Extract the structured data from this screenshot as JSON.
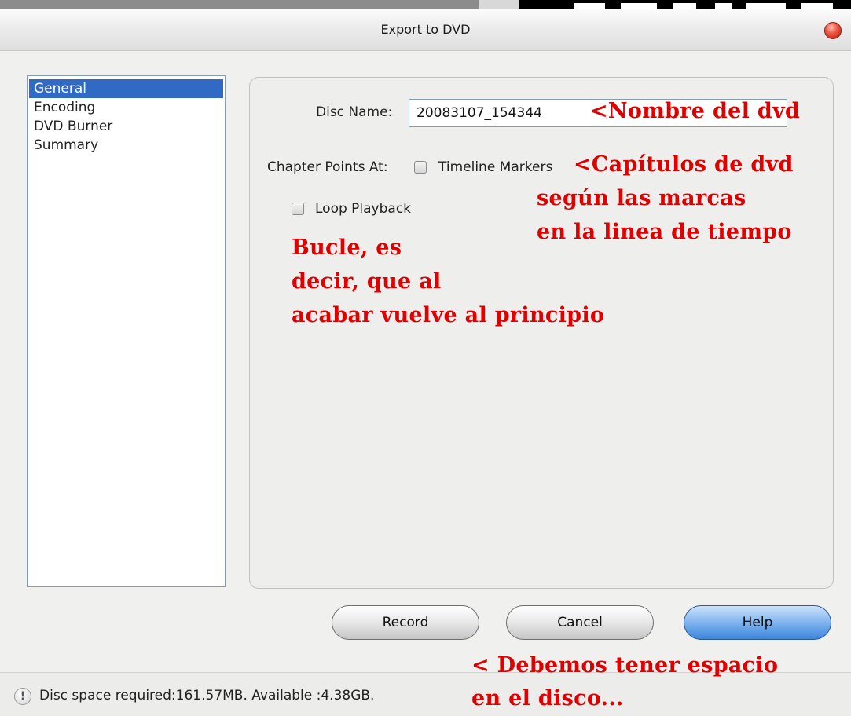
{
  "window": {
    "title": "Export to DVD"
  },
  "sidebar": {
    "items": [
      {
        "label": "General"
      },
      {
        "label": "Encoding"
      },
      {
        "label": "DVD Burner"
      },
      {
        "label": "Summary"
      }
    ]
  },
  "general": {
    "disc_name_label": "Disc Name:",
    "disc_name_value": "20083107_154344",
    "chapter_points_label": "Chapter Points At:",
    "timeline_markers_label": "Timeline Markers",
    "loop_playback_label": "Loop Playback"
  },
  "annotations": {
    "disc_name_note": "<Nombre del dvd",
    "chapters_note_1": "<Capítulos de dvd",
    "chapters_note_2": "según las marcas",
    "chapters_note_3": "en la linea de tiempo",
    "loop_note_1": "Bucle, es",
    "loop_note_2": "decir, que al",
    "loop_note_3": "acabar vuelve al principio",
    "space_note_1": "< Debemos tener espacio",
    "space_note_2": "en el disco..."
  },
  "buttons": {
    "record": "Record",
    "cancel": "Cancel",
    "help": "Help"
  },
  "status": {
    "text": "Disc space required:161.57MB. Available :4.38GB."
  },
  "colors": {
    "annotation": "#e00000",
    "selection": "#316ac5"
  }
}
